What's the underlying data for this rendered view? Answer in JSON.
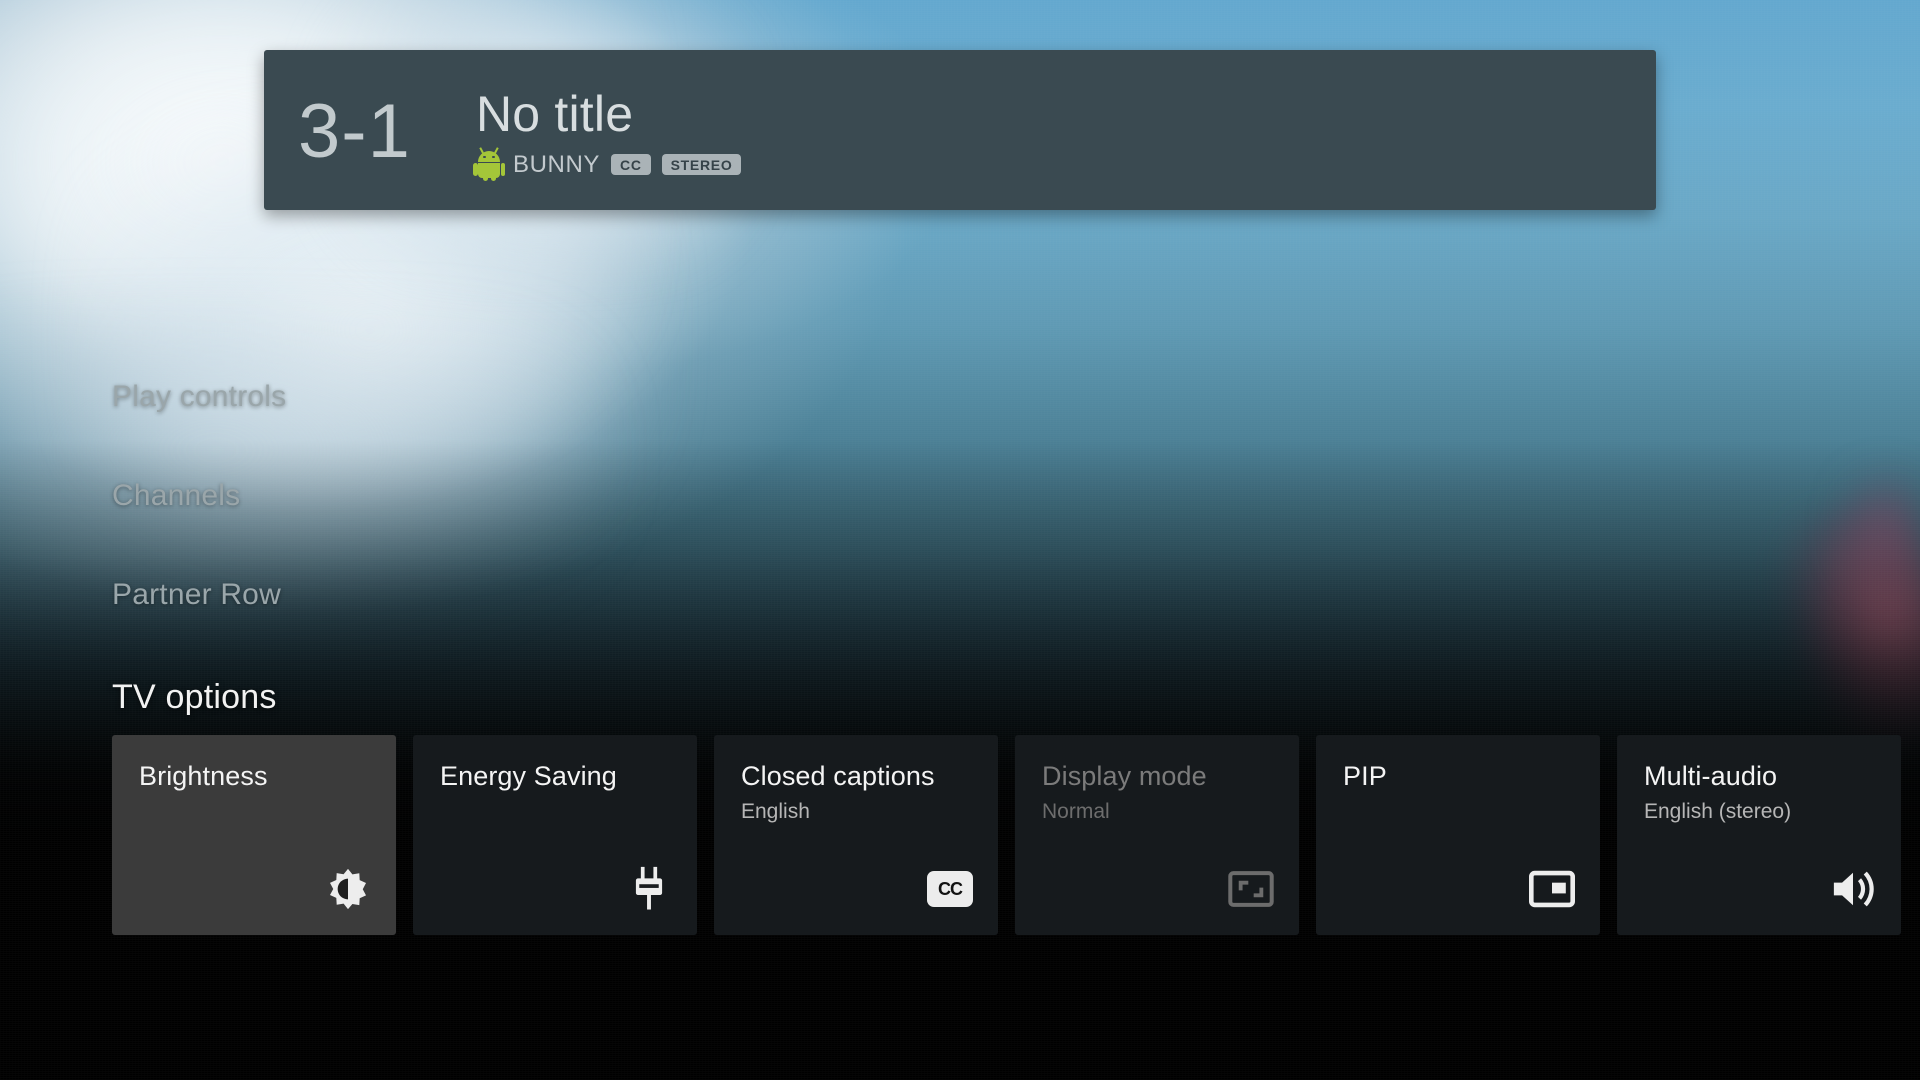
{
  "banner": {
    "channel_number": "3-1",
    "title": "No title",
    "source_name": "BUNNY",
    "android_icon": "android-robot-icon",
    "badges": [
      "CC",
      "STEREO"
    ],
    "panel_color": "#3a4a51"
  },
  "menu": {
    "items": [
      {
        "label": "Play controls"
      },
      {
        "label": "Channels"
      },
      {
        "label": "Partner Row"
      }
    ]
  },
  "tv_options": {
    "section_title": "TV options",
    "cards": [
      {
        "title": "Brightness",
        "subtitle": "",
        "icon": "brightness-icon",
        "focused": true,
        "disabled": false
      },
      {
        "title": "Energy Saving",
        "subtitle": "",
        "icon": "power-plug-icon",
        "focused": false,
        "disabled": false
      },
      {
        "title": "Closed captions",
        "subtitle": "English",
        "icon": "closed-caption-icon",
        "focused": false,
        "disabled": false
      },
      {
        "title": "Display mode",
        "subtitle": "Normal",
        "icon": "aspect-ratio-icon",
        "focused": false,
        "disabled": true
      },
      {
        "title": "PIP",
        "subtitle": "",
        "icon": "picture-in-picture-icon",
        "focused": false,
        "disabled": false
      },
      {
        "title": "Multi-audio",
        "subtitle": "English (stereo)",
        "icon": "volume-up-icon",
        "focused": false,
        "disabled": false
      }
    ]
  },
  "colors": {
    "focus_background": "#3b3b3b",
    "card_background": "#161a1d",
    "accent_green": "#a4c639",
    "sky_blue": "#63a8cf"
  }
}
